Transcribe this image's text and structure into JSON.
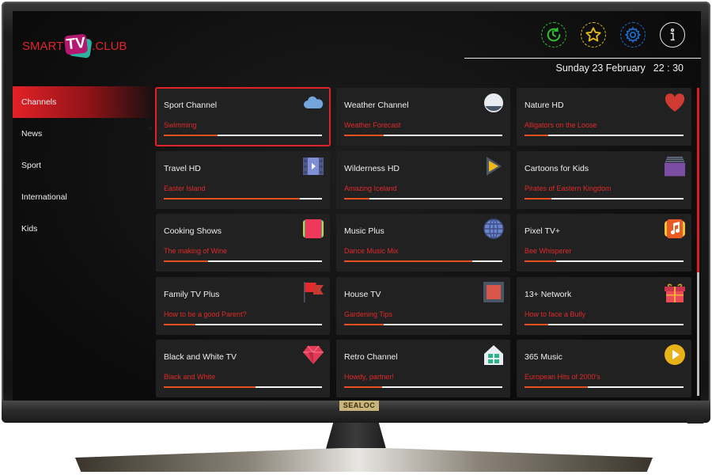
{
  "app": {
    "logo": {
      "left": "SMART",
      "middle": "TV",
      "right": ".CLUB"
    },
    "brand_badge": "SEALOC"
  },
  "header": {
    "icons": [
      {
        "name": "history-icon",
        "label": "History",
        "color": "#2fbf2f"
      },
      {
        "name": "favorites-star-icon",
        "label": "Favorites",
        "color": "#e3b81a"
      },
      {
        "name": "settings-gear-icon",
        "label": "Settings",
        "color": "#1f6fd1"
      },
      {
        "name": "info-icon",
        "label": "Info",
        "color": "#e8e8e8"
      }
    ],
    "date": "Sunday 23 February",
    "time": "22 : 30"
  },
  "sidebar": {
    "items": [
      {
        "label": "Channels",
        "active": true
      },
      {
        "label": "News",
        "active": false
      },
      {
        "label": "Sport",
        "active": false
      },
      {
        "label": "International",
        "active": false
      },
      {
        "label": "Kids",
        "active": false
      }
    ]
  },
  "colors": {
    "accent": "#e32127",
    "progress": "#e8501e",
    "subtitle": "#e02a2a",
    "card_bg": "#212121"
  },
  "channels": [
    {
      "title": "Sport Channel",
      "program": "Swimming",
      "progress": 0.34,
      "icon": "cloud-icon",
      "selected": true
    },
    {
      "title": "Weather Channel",
      "program": "Weather Forecast",
      "progress": 0.25,
      "icon": "moon-icon",
      "selected": false
    },
    {
      "title": "Nature HD",
      "program": "Alligators on the Loose",
      "progress": 0.15,
      "icon": "heart-icon",
      "selected": false
    },
    {
      "title": "Travel HD",
      "program": "Easter Island",
      "progress": 0.86,
      "icon": "film-icon",
      "selected": false
    },
    {
      "title": "Wilderness HD",
      "program": "Amazing Iceland",
      "progress": 0.16,
      "icon": "play-triangle-icon",
      "selected": false
    },
    {
      "title": "Cartoons for Kids",
      "program": "Pirates of Eastern Kingdom",
      "progress": 0.17,
      "icon": "stack-icon",
      "selected": false
    },
    {
      "title": "Cooking Shows",
      "program": "The making of Wine",
      "progress": 0.28,
      "icon": "book-icon",
      "selected": false
    },
    {
      "title": "Music Plus",
      "program": "Dance Music Mix",
      "progress": 0.81,
      "icon": "globe-icon",
      "selected": false
    },
    {
      "title": "Pixel TV+",
      "program": "Bee Whisperer",
      "progress": 0.2,
      "icon": "music-note-icon",
      "selected": false
    },
    {
      "title": "Family TV Plus",
      "program": "How to be a good Parent?",
      "progress": 0.2,
      "icon": "flag-icon",
      "selected": false
    },
    {
      "title": "House TV",
      "program": "Gardening Tips",
      "progress": 0.25,
      "icon": "square-icon",
      "selected": false
    },
    {
      "title": "13+ Network",
      "program": "How to face a Bully",
      "progress": 0.15,
      "icon": "gift-icon",
      "selected": false
    },
    {
      "title": "Black and White TV",
      "program": "Black and White",
      "progress": 0.58,
      "icon": "gem-icon",
      "selected": false
    },
    {
      "title": "Retro Channel",
      "program": "Howdy, partner!",
      "progress": 0.24,
      "icon": "house-icon",
      "selected": false
    },
    {
      "title": "365 Music",
      "program": "European Hits of 2000's",
      "progress": 0.4,
      "icon": "play-circle-icon",
      "selected": false
    }
  ],
  "scroll": {
    "position": 0.6
  }
}
